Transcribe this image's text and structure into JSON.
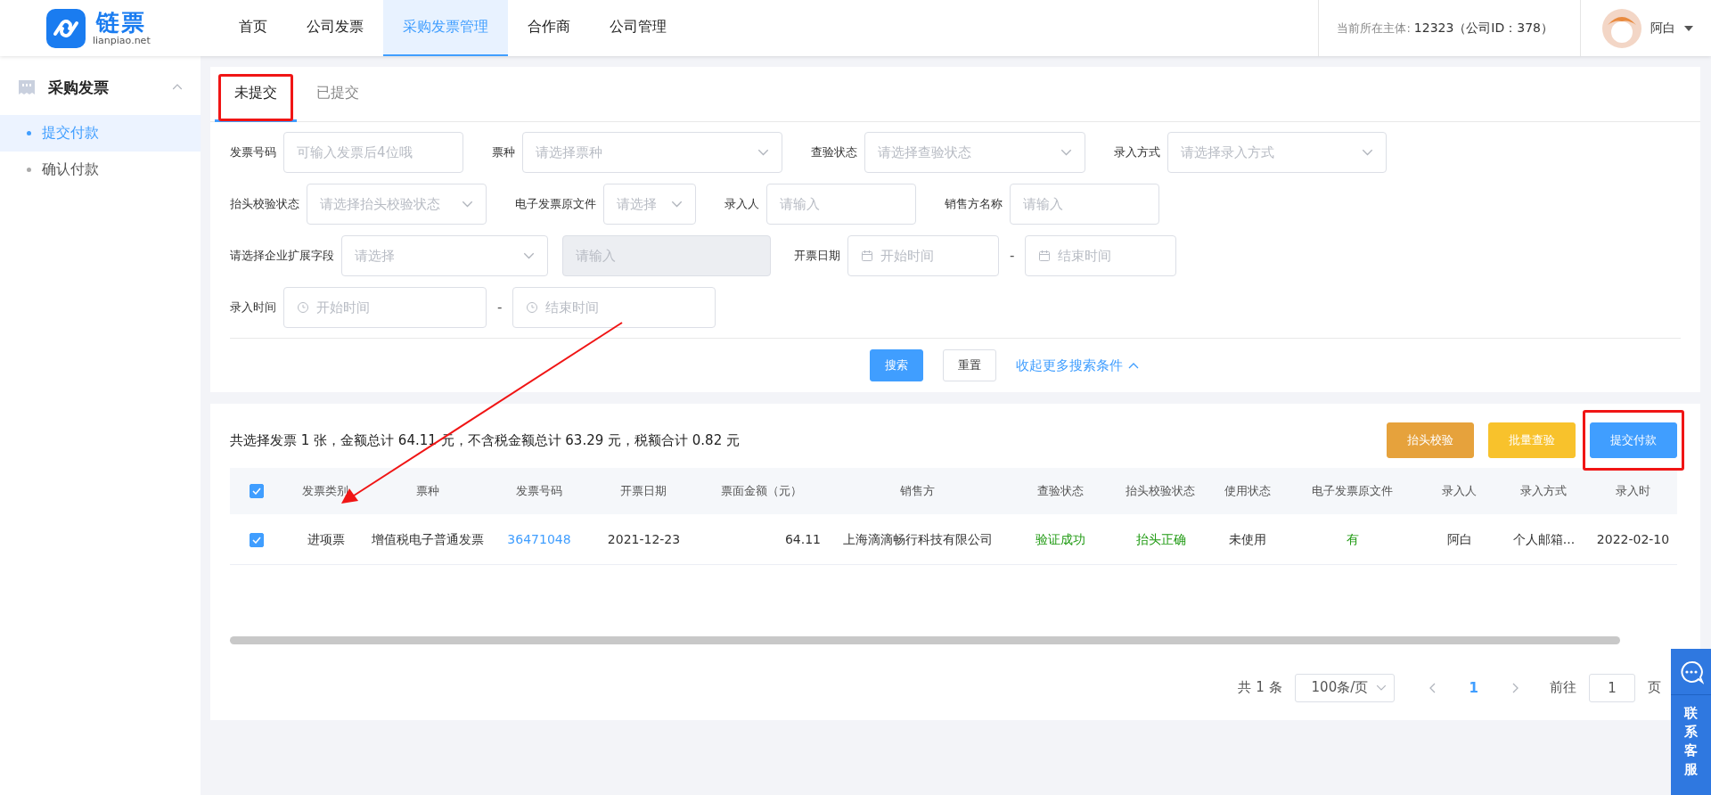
{
  "header": {
    "logo": {
      "name": "链票",
      "domain": "lianpiao.net"
    },
    "nav": [
      {
        "label": "首页",
        "selected": false
      },
      {
        "label": "公司发票",
        "selected": false
      },
      {
        "label": "采购发票管理",
        "selected": true
      },
      {
        "label": "合作商",
        "selected": false
      },
      {
        "label": "公司管理",
        "selected": false
      }
    ],
    "entity_label": "当前所在主体:",
    "entity_value": "12323（公司ID：378）",
    "user": "阿白"
  },
  "sidebar": {
    "group": {
      "label": "采购发票",
      "expanded": true,
      "items": [
        {
          "label": "提交付款",
          "selected": true
        },
        {
          "label": "确认付款",
          "selected": false
        }
      ]
    }
  },
  "tabs": [
    {
      "label": "未提交",
      "selected": true,
      "highlighted": true
    },
    {
      "label": "已提交",
      "selected": false,
      "highlighted": false
    }
  ],
  "filters": [
    [
      {
        "label": "发票号码",
        "kind": "input",
        "placeholder": "可输入发票后4位哦"
      },
      {
        "label": "票种",
        "kind": "select",
        "placeholder": "请选择票种"
      },
      {
        "label": "查验状态",
        "kind": "select",
        "placeholder": "请选择查验状态"
      },
      {
        "label": "录入方式",
        "kind": "select",
        "placeholder": "请选择录入方式"
      }
    ],
    [
      {
        "label": "抬头校验状态",
        "kind": "select",
        "placeholder": "请选择抬头校验状态"
      },
      {
        "label": "电子发票原文件",
        "kind": "select",
        "placeholder": "请选择"
      },
      {
        "label": "录入人",
        "kind": "input",
        "placeholder": "请输入"
      },
      {
        "label": "销售方名称",
        "kind": "input",
        "placeholder": "请输入"
      }
    ],
    [
      {
        "label": "请选择企业扩展字段",
        "kind": "select",
        "placeholder": "请选择"
      },
      {
        "kind": "input",
        "disabled": true,
        "placeholder": "请输入"
      },
      {
        "label": "开票日期",
        "kind": "date_range",
        "start": "开始时间",
        "separator": "-",
        "end": "结束时间"
      }
    ],
    [
      {
        "label": "录入时间",
        "kind": "time_range",
        "start": "开始时间",
        "separator": "-",
        "end": "结束时间"
      }
    ]
  ],
  "filter_actions": {
    "search": "搜索",
    "reset": "重置",
    "collapse": "收起更多搜索条件"
  },
  "summary": "共选择发票 1 张，金额总计 64.11 元，不含税金额总计 63.29 元，税额合计 0.82 元",
  "actions": [
    {
      "label": "抬头校验",
      "kind": "warning",
      "highlighted": false
    },
    {
      "label": "批量查验",
      "kind": "yellow",
      "highlighted": false
    },
    {
      "label": "提交付款",
      "kind": "primary",
      "highlighted": true
    }
  ],
  "table": {
    "all_checked": true,
    "columns": [
      "发票类别",
      "票种",
      "发票号码",
      "开票日期",
      "票面金额（元）",
      "销售方",
      "查验状态",
      "抬头校验状态",
      "使用状态",
      "电子发票原文件",
      "录入人",
      "录入方式",
      "录入时"
    ],
    "rows": [
      {
        "checked": true,
        "cells": [
          {
            "text": "进项票",
            "kind": "plain"
          },
          {
            "text": "增值税电子普通发票",
            "kind": "plain"
          },
          {
            "text": "36471048",
            "kind": "link"
          },
          {
            "text": "2021-12-23",
            "kind": "plain"
          },
          {
            "text": "64.11",
            "kind": "number"
          },
          {
            "text": "上海滴滴畅行科技有限公司",
            "kind": "plain"
          },
          {
            "text": "验证成功",
            "kind": "success"
          },
          {
            "text": "抬头正确",
            "kind": "success"
          },
          {
            "text": "未使用",
            "kind": "plain"
          },
          {
            "text": "有",
            "kind": "success"
          },
          {
            "text": "阿白",
            "kind": "plain"
          },
          {
            "text": "个人邮箱...",
            "kind": "plain"
          },
          {
            "text": "2022-02-10",
            "kind": "plain"
          }
        ]
      }
    ]
  },
  "pagination": {
    "total": "共 1 条",
    "page_size": "100条/页",
    "pages": [
      {
        "label": "1",
        "selected": true
      }
    ],
    "goto_label": "前往",
    "goto_value": "1",
    "goto_suffix": "页"
  },
  "contact": {
    "label": "联系客服"
  }
}
